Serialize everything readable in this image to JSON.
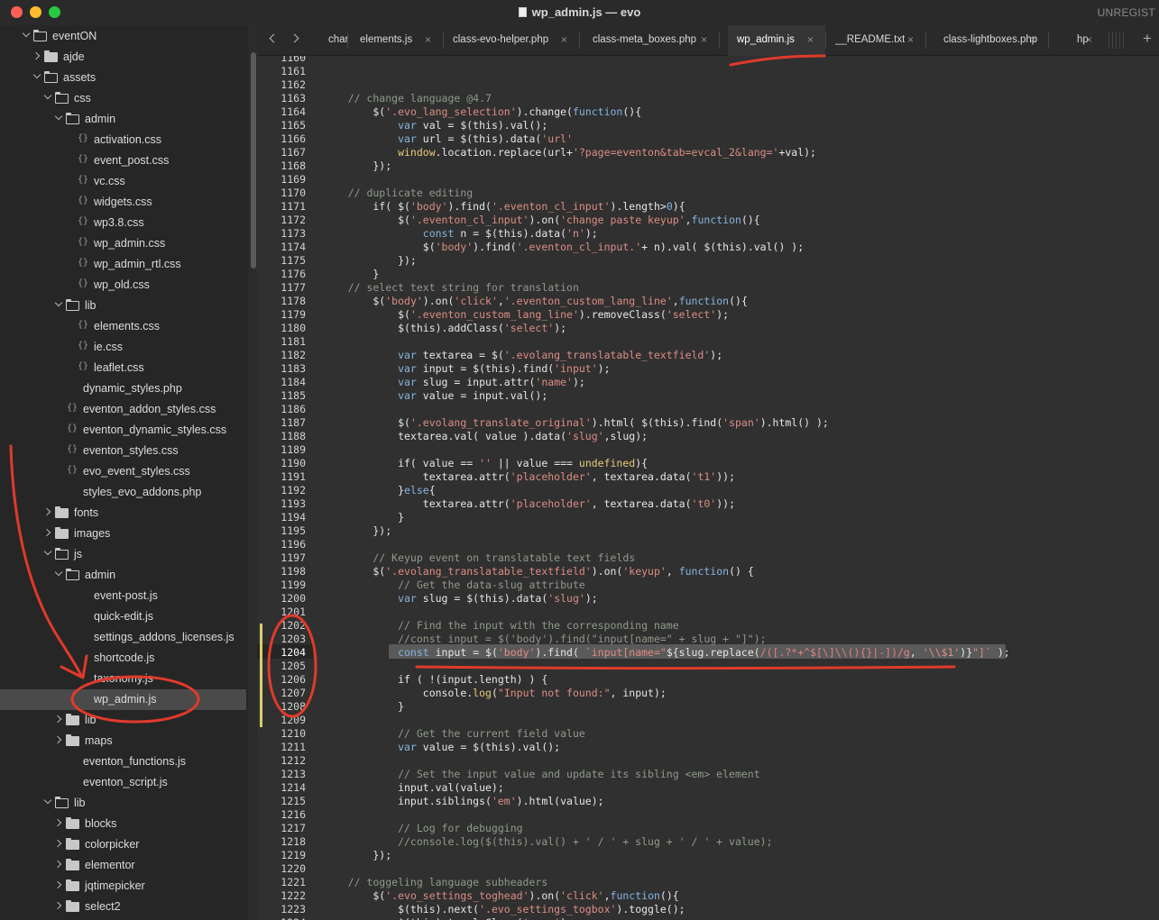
{
  "window": {
    "title": "wp_admin.js — evo",
    "registration": "UNREGIST"
  },
  "sidebar": {
    "items": [
      {
        "label": "eventON",
        "kind": "folder-open",
        "depth": 0
      },
      {
        "label": "ajde",
        "kind": "folder",
        "depth": 1
      },
      {
        "label": "assets",
        "kind": "folder-open",
        "depth": 1
      },
      {
        "label": "css",
        "kind": "folder-open",
        "depth": 2
      },
      {
        "label": "admin",
        "kind": "folder-open",
        "depth": 3
      },
      {
        "label": "activation.css",
        "kind": "css",
        "depth": 4
      },
      {
        "label": "event_post.css",
        "kind": "css",
        "depth": 4
      },
      {
        "label": "vc.css",
        "kind": "css",
        "depth": 4
      },
      {
        "label": "widgets.css",
        "kind": "css",
        "depth": 4
      },
      {
        "label": "wp3.8.css",
        "kind": "css",
        "depth": 4
      },
      {
        "label": "wp_admin.css",
        "kind": "css",
        "depth": 4
      },
      {
        "label": "wp_admin_rtl.css",
        "kind": "css",
        "depth": 4
      },
      {
        "label": "wp_old.css",
        "kind": "css",
        "depth": 4
      },
      {
        "label": "lib",
        "kind": "folder-open",
        "depth": 3
      },
      {
        "label": "elements.css",
        "kind": "css",
        "depth": 4
      },
      {
        "label": "ie.css",
        "kind": "css",
        "depth": 4
      },
      {
        "label": "leaflet.css",
        "kind": "css",
        "depth": 4
      },
      {
        "label": "dynamic_styles.php",
        "kind": "file",
        "depth": 3
      },
      {
        "label": "eventon_addon_styles.css",
        "kind": "css",
        "depth": 3
      },
      {
        "label": "eventon_dynamic_styles.css",
        "kind": "css",
        "depth": 3
      },
      {
        "label": "eventon_styles.css",
        "kind": "css",
        "depth": 3
      },
      {
        "label": "evo_event_styles.css",
        "kind": "css",
        "depth": 3
      },
      {
        "label": "styles_evo_addons.php",
        "kind": "file",
        "depth": 3
      },
      {
        "label": "fonts",
        "kind": "folder",
        "depth": 2
      },
      {
        "label": "images",
        "kind": "folder",
        "depth": 2
      },
      {
        "label": "js",
        "kind": "folder-open",
        "depth": 2
      },
      {
        "label": "admin",
        "kind": "folder-open",
        "depth": 3
      },
      {
        "label": "event-post.js",
        "kind": "file",
        "depth": 4
      },
      {
        "label": "quick-edit.js",
        "kind": "file",
        "depth": 4
      },
      {
        "label": "settings_addons_licenses.js",
        "kind": "file",
        "depth": 4
      },
      {
        "label": "shortcode.js",
        "kind": "file",
        "depth": 4
      },
      {
        "label": "taxonomy.js",
        "kind": "file",
        "depth": 4
      },
      {
        "label": "wp_admin.js",
        "kind": "file",
        "depth": 4,
        "selected": true
      },
      {
        "label": "lib",
        "kind": "folder",
        "depth": 3
      },
      {
        "label": "maps",
        "kind": "folder",
        "depth": 3
      },
      {
        "label": "eventon_functions.js",
        "kind": "file",
        "depth": 3
      },
      {
        "label": "eventon_script.js",
        "kind": "file",
        "depth": 3
      },
      {
        "label": "lib",
        "kind": "folder-open",
        "depth": 2
      },
      {
        "label": "blocks",
        "kind": "folder",
        "depth": 3
      },
      {
        "label": "colorpicker",
        "kind": "folder",
        "depth": 3
      },
      {
        "label": "elementor",
        "kind": "folder",
        "depth": 3
      },
      {
        "label": "jqtimepicker",
        "kind": "folder",
        "depth": 3
      },
      {
        "label": "select2",
        "kind": "folder",
        "depth": 3
      }
    ]
  },
  "tabs": [
    {
      "label": "char"
    },
    {
      "label": "elements.js"
    },
    {
      "label": "class-evo-helper.php"
    },
    {
      "label": "class-meta_boxes.php"
    },
    {
      "label": "wp_admin.js",
      "active": true
    },
    {
      "label": "__README.txt"
    },
    {
      "label": "class-lightboxes.php"
    },
    {
      "label": "hp"
    }
  ],
  "tab_close_glyph": "×",
  "tab_add_glyph": "+",
  "editor": {
    "first_line": 1160,
    "current_line": 1204,
    "lines": [
      [
        [
          "",
          "1160"
        ]
      ],
      [],
      [],
      [
        [
          "cm",
          "    // change language @4.7"
        ]
      ],
      [
        [
          "",
          "        $("
        ],
        [
          "st",
          "'.evo_lang_selection'"
        ],
        [
          "",
          ").change("
        ],
        [
          "kw",
          "function"
        ],
        [
          "",
          "(){"
        ]
      ],
      [
        [
          "kw",
          "            var"
        ],
        [
          "",
          " val = $(this).val();"
        ]
      ],
      [
        [
          "kw",
          "            var"
        ],
        [
          "",
          " url = $(this).data("
        ],
        [
          "st",
          "'url'"
        ],
        [
          ");"
        ]
      ],
      [
        [
          "kw2",
          "            window"
        ],
        [
          "",
          ".location.replace(url+"
        ],
        [
          "st",
          "'?page=eventon&tab=evcal_2&lang='"
        ],
        [
          "",
          "+val);"
        ]
      ],
      [
        [
          "",
          "        });"
        ]
      ],
      [],
      [
        [
          "cm",
          "    // duplicate editing"
        ]
      ],
      [
        [
          "",
          "        if( $("
        ],
        [
          "st",
          "'body'"
        ],
        [
          "",
          ").find("
        ],
        [
          "st",
          "'.eventon_cl_input'"
        ],
        [
          "",
          ").length>"
        ],
        [
          "kw",
          "0"
        ],
        [
          "",
          "){"
        ]
      ],
      [
        [
          "",
          "            $("
        ],
        [
          "st",
          "'.eventon_cl_input'"
        ],
        [
          "",
          ").on("
        ],
        [
          "st",
          "'change paste keyup'"
        ],
        [
          "",
          ","
        ],
        [
          "kw",
          "function"
        ],
        [
          "",
          "(){"
        ]
      ],
      [
        [
          "kw",
          "                const"
        ],
        [
          "",
          " n = $(this).data("
        ],
        [
          "st",
          "'n'"
        ],
        [
          "",
          ");"
        ]
      ],
      [
        [
          "",
          "                $("
        ],
        [
          "st",
          "'body'"
        ],
        [
          "",
          ").find("
        ],
        [
          "st",
          "'.eventon_cl_input.'"
        ],
        [
          "",
          "+ n).val( $(this).val() );"
        ]
      ],
      [
        [
          "",
          "            });"
        ]
      ],
      [
        [
          "",
          "        }"
        ]
      ],
      [
        [
          "cm",
          "    // select text string for translation"
        ]
      ],
      [
        [
          "",
          "        $("
        ],
        [
          "st",
          "'body'"
        ],
        [
          "",
          ").on("
        ],
        [
          "st",
          "'click'"
        ],
        [
          "",
          ","
        ],
        [
          "st",
          "'.eventon_custom_lang_line'"
        ],
        [
          "",
          ","
        ],
        [
          "kw",
          "function"
        ],
        [
          "",
          "(){"
        ]
      ],
      [
        [
          "",
          "            $("
        ],
        [
          "st",
          "'.eventon_custom_lang_line'"
        ],
        [
          "",
          ").removeClass("
        ],
        [
          "st",
          "'select'"
        ],
        [
          "",
          ");"
        ]
      ],
      [
        [
          "",
          "            $(this).addClass("
        ],
        [
          "st",
          "'select'"
        ],
        [
          "",
          ");"
        ]
      ],
      [],
      [
        [
          "kw",
          "            var"
        ],
        [
          "",
          " textarea = $("
        ],
        [
          "st",
          "'.evolang_translatable_textfield'"
        ],
        [
          "",
          ");"
        ]
      ],
      [
        [
          "kw",
          "            var"
        ],
        [
          "",
          " input = $(this).find("
        ],
        [
          "st",
          "'input'"
        ],
        [
          "",
          ");"
        ]
      ],
      [
        [
          "kw",
          "            var"
        ],
        [
          "",
          " slug = input.attr("
        ],
        [
          "st",
          "'name'"
        ],
        [
          "",
          ");"
        ]
      ],
      [
        [
          "kw",
          "            var"
        ],
        [
          "",
          " value = input.val();"
        ]
      ],
      [],
      [
        [
          "",
          "            $("
        ],
        [
          "st",
          "'.evolang_translate_original'"
        ],
        [
          "",
          ").html( $(this).find("
        ],
        [
          "st",
          "'span'"
        ],
        [
          "",
          ").html() );"
        ]
      ],
      [
        [
          "",
          "            textarea.val( value ).data("
        ],
        [
          "st",
          "'slug'"
        ],
        [
          "",
          ",slug);"
        ]
      ],
      [],
      [
        [
          "",
          "            if( value == "
        ],
        [
          "st",
          "''"
        ],
        [
          "",
          " || value === "
        ],
        [
          "kw2",
          "undefined"
        ],
        [
          "",
          "){"
        ]
      ],
      [
        [
          "",
          "                textarea.attr("
        ],
        [
          "st",
          "'placeholder'"
        ],
        [
          "",
          ", textarea.data("
        ],
        [
          "st",
          "'t1'"
        ],
        [
          "",
          "));"
        ]
      ],
      [
        [
          "",
          "            }"
        ],
        [
          "kw",
          "else"
        ],
        [
          "",
          "{"
        ]
      ],
      [
        [
          "",
          "                textarea.attr("
        ],
        [
          "st",
          "'placeholder'"
        ],
        [
          "",
          ", textarea.data("
        ],
        [
          "st",
          "'t0'"
        ],
        [
          "",
          "));"
        ]
      ],
      [
        [
          "",
          "            }"
        ]
      ],
      [
        [
          "",
          "        });"
        ]
      ],
      [],
      [
        [
          "cm",
          "        // Keyup event on translatable text fields"
        ]
      ],
      [
        [
          "",
          "        $("
        ],
        [
          "st",
          "'.evolang_translatable_textfield'"
        ],
        [
          "",
          ").on("
        ],
        [
          "st",
          "'keyup'"
        ],
        [
          "",
          ", "
        ],
        [
          "kw",
          "function"
        ],
        [
          "",
          "() {"
        ]
      ],
      [
        [
          "cm",
          "            // Get the data-slug attribute"
        ]
      ],
      [
        [
          "kw",
          "            var"
        ],
        [
          "",
          " slug = $(this).data("
        ],
        [
          "st",
          "'slug'"
        ],
        [
          "",
          ");"
        ]
      ],
      [],
      [
        [
          "cm",
          "            // Find the input with the corresponding name"
        ]
      ],
      [
        [
          "cm",
          "            //const input = $('body').find(\"input[name=\" + slug + \"]\");"
        ]
      ],
      [
        [
          "kw",
          "            const"
        ],
        [
          "",
          " input = $("
        ],
        [
          "st",
          "'body'"
        ],
        [
          "",
          ").find( "
        ],
        [
          "st",
          "`input[name=\""
        ],
        [
          "",
          "${slug.replace("
        ],
        [
          "rx",
          "/([.?*+^$[\\]\\\\(){}|-])/g"
        ],
        [
          "",
          ", "
        ],
        [
          "st",
          "'\\\\$1'"
        ],
        [
          "",
          ")}"
        ],
        [
          "st",
          "\"]`"
        ],
        [
          "",
          " );"
        ]
      ],
      [],
      [
        [
          "",
          "            if ( !(input.length) ) {"
        ]
      ],
      [
        [
          "",
          "                console."
        ],
        [
          "kw2",
          "log"
        ],
        [
          "",
          "("
        ],
        [
          "st",
          "\"Input not found:\""
        ],
        [
          "",
          ", input);"
        ]
      ],
      [
        [
          "",
          "            }"
        ]
      ],
      [],
      [
        [
          "cm",
          "            // Get the current field value"
        ]
      ],
      [
        [
          "kw",
          "            var"
        ],
        [
          "",
          " value = $(this).val();"
        ]
      ],
      [],
      [
        [
          "cm",
          "            // Set the input value and update its sibling <em> element"
        ]
      ],
      [
        [
          "",
          "            input.val(value);"
        ]
      ],
      [
        [
          "",
          "            input.siblings("
        ],
        [
          "st",
          "'em'"
        ],
        [
          "",
          ").html(value);"
        ]
      ],
      [],
      [
        [
          "cm",
          "            // Log for debugging"
        ]
      ],
      [
        [
          "cm",
          "            //console.log($(this).val() + ' / ' + slug + ' / ' + value);"
        ]
      ],
      [
        [
          "",
          "        });"
        ]
      ],
      [],
      [
        [
          "cm",
          "    // toggeling language subheaders"
        ]
      ],
      [
        [
          "",
          "        $("
        ],
        [
          "st",
          "'.evo_settings_toghead'"
        ],
        [
          "",
          ").on("
        ],
        [
          "st",
          "'click'"
        ],
        [
          "",
          ","
        ],
        [
          "kw",
          "function"
        ],
        [
          "",
          "(){"
        ]
      ],
      [
        [
          "",
          "            $(this).next("
        ],
        [
          "st",
          "'.evo_settings_togbox'"
        ],
        [
          "",
          ").toggle();"
        ]
      ],
      [
        [
          "",
          "            $(this).toggleClass("
        ],
        [
          "st",
          "'open'"
        ],
        [
          "",
          ");"
        ]
      ]
    ]
  },
  "colors": {
    "annotation": "#e03a2a",
    "comment": "#8f9a8a",
    "string": "#dd8d84",
    "keyword": "#87b4e0"
  }
}
